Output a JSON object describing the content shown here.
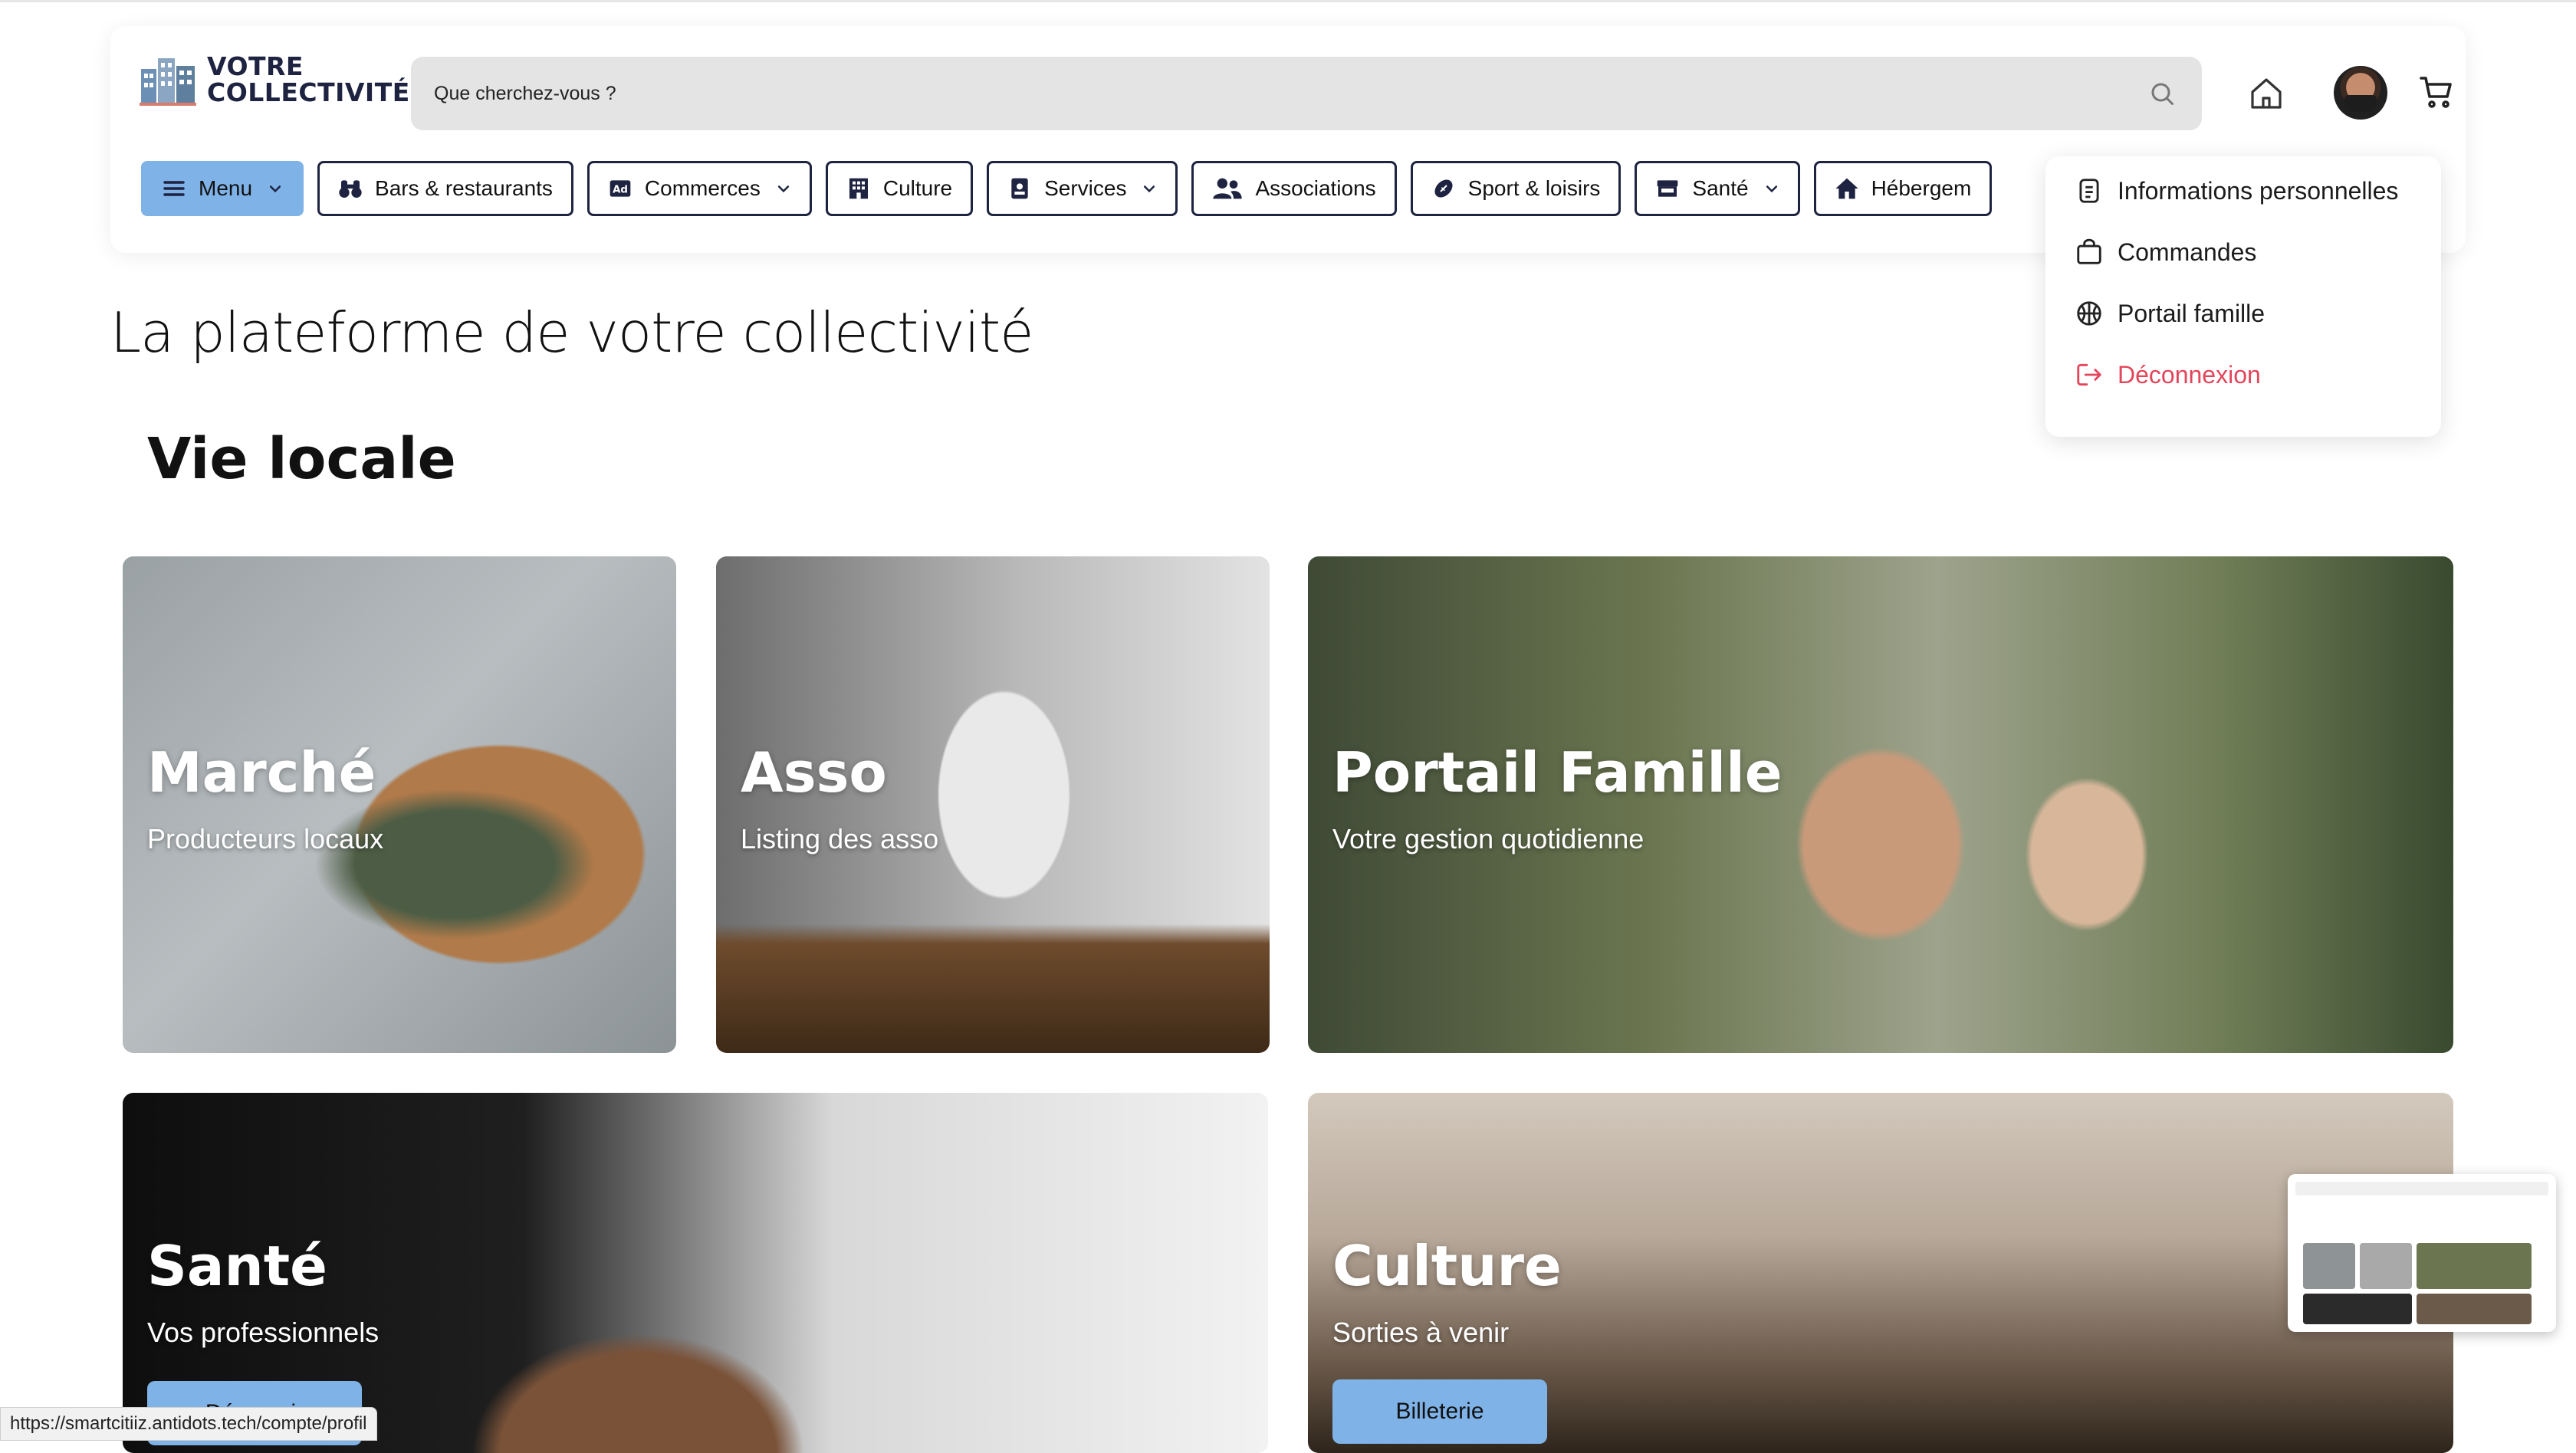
{
  "app": {
    "logo_line1": "VOTRE",
    "logo_line2": "COLLECTIVITÉ"
  },
  "search": {
    "placeholder": "Que cherchez-vous ?"
  },
  "nav": {
    "items": [
      {
        "label": "Menu",
        "icon": "hamburger-icon",
        "chevron": true
      },
      {
        "label": "Bars & restaurants",
        "icon": "binoculars-icon",
        "chevron": false
      },
      {
        "label": "Commerces",
        "icon": "ad-icon",
        "chevron": true
      },
      {
        "label": "Culture",
        "icon": "building-icon",
        "chevron": false
      },
      {
        "label": "Services",
        "icon": "badge-icon",
        "chevron": true
      },
      {
        "label": "Associations",
        "icon": "users-icon",
        "chevron": false
      },
      {
        "label": "Sport & loisirs",
        "icon": "football-icon",
        "chevron": false
      },
      {
        "label": "Santé",
        "icon": "store-icon",
        "chevron": true
      },
      {
        "label": "Hébergem",
        "icon": "home-icon",
        "chevron": false
      }
    ]
  },
  "user_menu": {
    "items": [
      {
        "label": "Informations personnelles",
        "icon": "document-icon"
      },
      {
        "label": "Commandes",
        "icon": "shopping-bag-icon"
      },
      {
        "label": "Portail famille",
        "icon": "basketball-icon"
      },
      {
        "label": "Déconnexion",
        "icon": "logout-icon"
      }
    ]
  },
  "page": {
    "title": "La plateforme de votre collectivité",
    "section_title": "Vie locale"
  },
  "cards": {
    "marche": {
      "title": "Marché",
      "subtitle": "Producteurs locaux"
    },
    "asso": {
      "title": "Asso",
      "subtitle": "Listing des asso"
    },
    "famille": {
      "title": "Portail Famille",
      "subtitle": "Votre gestion quotidienne"
    },
    "sante": {
      "title": "Santé",
      "subtitle": "Vos professionnels",
      "button": "Découvrir"
    },
    "culture": {
      "title": "Culture",
      "subtitle": "Sorties à venir",
      "button": "Billeterie"
    }
  },
  "status_bar": {
    "url": "https://smartcitiiz.antidots.tech/compte/profil"
  },
  "colors": {
    "accent": "#7fb3e8",
    "navy": "#1d2340",
    "danger": "#e2465a"
  }
}
